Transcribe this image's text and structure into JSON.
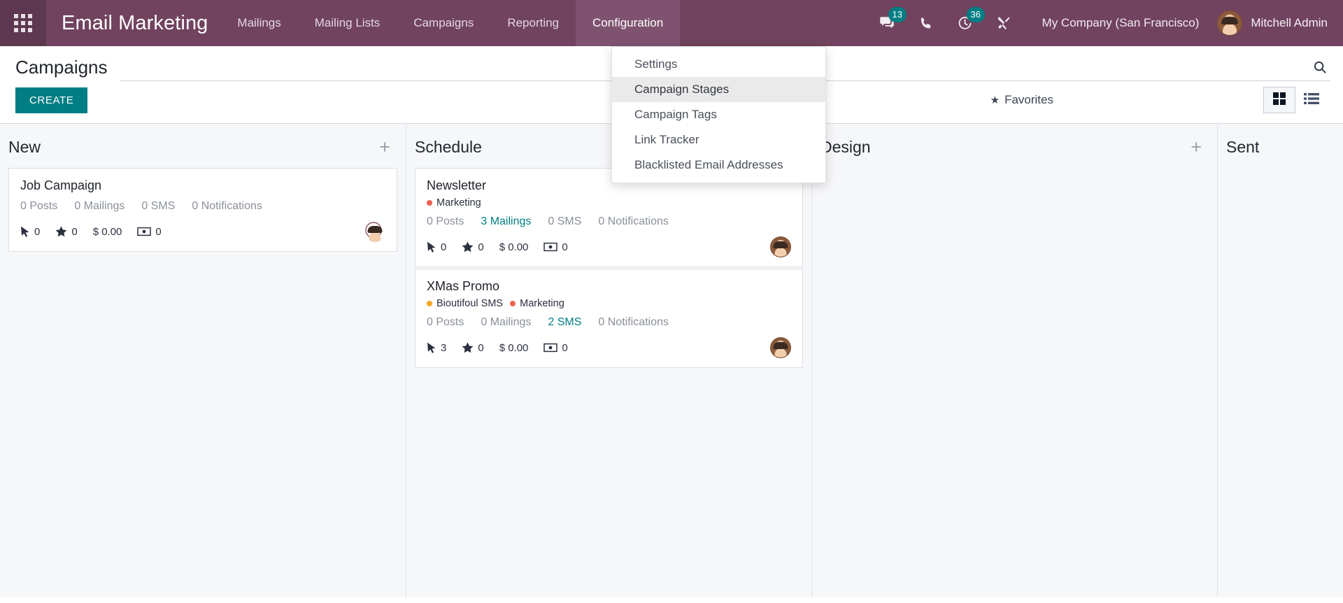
{
  "navbar": {
    "apps_icon": "apps-grid-icon",
    "brand": "Email Marketing",
    "menus": [
      {
        "label": "Mailings",
        "active": false
      },
      {
        "label": "Mailing Lists",
        "active": false
      },
      {
        "label": "Campaigns",
        "active": false
      },
      {
        "label": "Reporting",
        "active": false
      },
      {
        "label": "Configuration",
        "active": true
      }
    ],
    "systray": {
      "messages_icon": "chat-bubble-icon",
      "messages_count": "13",
      "voip_icon": "phone-icon",
      "activities_icon": "clock-activity-icon",
      "activities_count": "36",
      "debug_icon": "wrench-tools-icon"
    },
    "company": "My Company (San Francisco)",
    "user": "Mitchell Admin",
    "avatar_icon": "user-avatar"
  },
  "dropdown": {
    "open_for": "Configuration",
    "items": [
      {
        "label": "Settings",
        "highlighted": false
      },
      {
        "label": "Campaign Stages",
        "highlighted": true
      },
      {
        "label": "Campaign Tags",
        "highlighted": false
      },
      {
        "label": "Link Tracker",
        "highlighted": false
      },
      {
        "label": "Blacklisted Email Addresses",
        "highlighted": false
      }
    ]
  },
  "control_panel": {
    "title": "Campaigns",
    "create_label": "CREATE",
    "search_placeholder": "",
    "search_icon": "search-icon",
    "favorites_label": "Favorites",
    "favorites_star_icon": "star-icon",
    "views": [
      {
        "name": "kanban-view-button",
        "icon": "grid-icon",
        "active": true
      },
      {
        "name": "list-view-button",
        "icon": "list-icon",
        "active": false
      }
    ]
  },
  "colors": {
    "navbar": "#71435f",
    "navbar_active": "#7f5370",
    "accent_teal": "#017e84",
    "badge": "#017e84",
    "kanban_bg": "#f6f7f9",
    "tag_marketing": "#f06050",
    "tag_bioutifoul": "#f5a623"
  },
  "kanban": {
    "columns": [
      {
        "title": "New",
        "add_icon": "plus-icon",
        "cards": [
          {
            "title": "Job Campaign",
            "tags": [],
            "counts": [
              {
                "label": "0 Posts",
                "link": false
              },
              {
                "label": "0 Mailings",
                "link": false
              },
              {
                "label": "0 SMS",
                "link": false
              },
              {
                "label": "0 Notifications",
                "link": false
              }
            ],
            "stats": {
              "clicks_icon": "cursor-arrow-icon",
              "clicks": "0",
              "leads_icon": "star-icon",
              "leads": "0",
              "revenue_icon": "dollar-icon",
              "revenue": "$ 0.00",
              "invoiced_icon": "banknote-icon",
              "invoiced": "0"
            },
            "avatar": "smiley-placeholder-icon"
          }
        ]
      },
      {
        "title": "Schedule",
        "add_icon": "plus-icon",
        "cards": [
          {
            "title": "Newsletter",
            "tags": [
              {
                "label": "Marketing",
                "color": "#f06050"
              }
            ],
            "counts": [
              {
                "label": "0 Posts",
                "link": false
              },
              {
                "label": "3 Mailings",
                "link": true
              },
              {
                "label": "0 SMS",
                "link": false
              },
              {
                "label": "0 Notifications",
                "link": false
              }
            ],
            "stats": {
              "clicks_icon": "cursor-arrow-icon",
              "clicks": "0",
              "leads_icon": "star-icon",
              "leads": "0",
              "revenue_icon": "dollar-icon",
              "revenue": "$ 0.00",
              "invoiced_icon": "banknote-icon",
              "invoiced": "0"
            },
            "avatar": "user-avatar"
          },
          {
            "title": "XMas Promo",
            "tags": [
              {
                "label": "Bioutifoul SMS",
                "color": "#f5a623"
              },
              {
                "label": "Marketing",
                "color": "#f06050"
              }
            ],
            "counts": [
              {
                "label": "0 Posts",
                "link": false
              },
              {
                "label": "0 Mailings",
                "link": false
              },
              {
                "label": "2 SMS",
                "link": true
              },
              {
                "label": "0 Notifications",
                "link": false
              }
            ],
            "stats": {
              "clicks_icon": "cursor-arrow-icon",
              "clicks": "3",
              "leads_icon": "star-icon",
              "leads": "0",
              "revenue_icon": "dollar-icon",
              "revenue": "$ 0.00",
              "invoiced_icon": "banknote-icon",
              "invoiced": "0"
            },
            "avatar": "user-avatar"
          }
        ]
      },
      {
        "title": "Design",
        "add_icon": "plus-icon",
        "cards": []
      },
      {
        "title": "Sent",
        "add_icon": "plus-icon",
        "cards": []
      }
    ]
  }
}
